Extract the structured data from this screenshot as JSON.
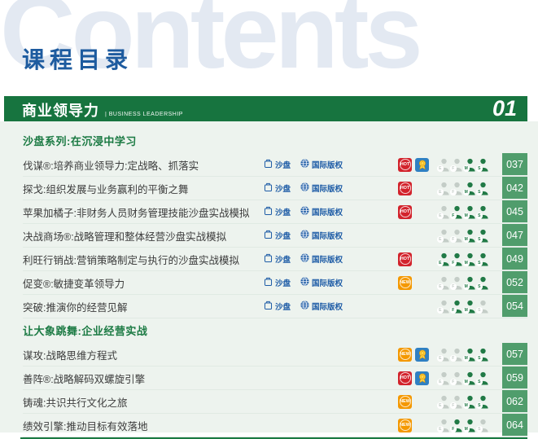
{
  "header": {
    "watermark": "Contents",
    "title": "课程目录"
  },
  "category": {
    "name": "商业领导力",
    "name_en": "| BUSINESS LEADERSHIP",
    "number": "01"
  },
  "labels": {
    "sandbox": "沙盘",
    "intl": "国际版权",
    "audience": [
      "E",
      "F",
      "M",
      "S"
    ]
  },
  "badge_labels": {
    "hot": "HOT",
    "new": "NEW",
    "award": "medal"
  },
  "colors": {
    "bar_green": "#17743f",
    "strip_green": "#509d6c",
    "section_green": "#1b7a43",
    "link_blue": "#1e5ca6",
    "title_blue": "#1d5b9f",
    "hot_red": "#d2232c",
    "new_orange": "#f49800",
    "award_blue": "#2f80c3"
  },
  "sections": [
    {
      "title": "沙盘系列:在沉浸中学习",
      "courses": [
        {
          "title": "伐谋®:培养商业领导力:定战略、抓落实",
          "sandbox": true,
          "intl": true,
          "badges": [
            "hot",
            "award"
          ],
          "audience": [
            0,
            0,
            1,
            1
          ],
          "page": "037"
        },
        {
          "title": "探戈:组织发展与业务赢利的平衡之舞",
          "sandbox": true,
          "intl": true,
          "badges": [
            "hot"
          ],
          "audience": [
            0,
            0,
            1,
            1
          ],
          "page": "042"
        },
        {
          "title": "苹果加橘子:非财务人员财务管理技能沙盘实战模拟",
          "sandbox": true,
          "intl": true,
          "badges": [
            "hot"
          ],
          "audience": [
            0,
            1,
            1,
            1
          ],
          "page": "045"
        },
        {
          "title": "决战商场®:战略管理和整体经营沙盘实战模拟",
          "sandbox": true,
          "intl": true,
          "badges": [],
          "audience": [
            0,
            0,
            1,
            1
          ],
          "page": "047"
        },
        {
          "title": "利旺行销战:营销策略制定与执行的沙盘实战模拟",
          "sandbox": true,
          "intl": true,
          "badges": [
            "hot"
          ],
          "audience": [
            1,
            1,
            1,
            1
          ],
          "page": "049"
        },
        {
          "title": "促变®:敏捷变革领导力",
          "sandbox": true,
          "intl": true,
          "badges": [
            "new"
          ],
          "audience": [
            0,
            0,
            1,
            1
          ],
          "page": "052"
        },
        {
          "title": "突破:推演你的经营见解",
          "sandbox": true,
          "intl": true,
          "badges": [],
          "audience": [
            0,
            1,
            1,
            0
          ],
          "page": "054"
        }
      ]
    },
    {
      "title": "让大象跳舞:企业经营实战",
      "courses": [
        {
          "title": "谋攻:战略思维方程式",
          "sandbox": false,
          "intl": false,
          "badges": [
            "new",
            "award"
          ],
          "audience": [
            0,
            0,
            1,
            1
          ],
          "page": "057"
        },
        {
          "title": "善阵®:战略解码双螺旋引擎",
          "sandbox": false,
          "intl": false,
          "badges": [
            "hot",
            "award"
          ],
          "audience": [
            0,
            0,
            1,
            1
          ],
          "page": "059"
        },
        {
          "title": "铸魂:共识共行文化之旅",
          "sandbox": false,
          "intl": false,
          "badges": [
            "new"
          ],
          "audience": [
            0,
            0,
            1,
            1
          ],
          "page": "062"
        },
        {
          "title": "绩效引擎:推动目标有效落地",
          "sandbox": false,
          "intl": false,
          "badges": [
            "new"
          ],
          "audience": [
            0,
            1,
            1,
            0
          ],
          "page": "064"
        }
      ]
    }
  ]
}
